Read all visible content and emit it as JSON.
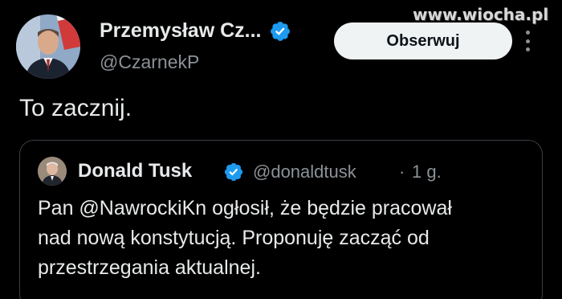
{
  "author": {
    "name": "Przemysław Cz...",
    "handle": "@CzarnekP"
  },
  "follow_button_label": "Obserwuj",
  "watermark": "www.wiocha.pl",
  "tweet": {
    "text": "To zacznij."
  },
  "quoted": {
    "name": "Donald Tusk",
    "handle": "@donaldtusk",
    "separator": "·",
    "time": "1 g.",
    "body_lines": [
      "Pan @NawrockiKn ogłosił, że będzie pracował",
      "nad nową konstytucją. Proponuję zacząć od",
      "przestrzegania aktualnej."
    ]
  },
  "colors": {
    "background": "#000000",
    "text": "#e7e9ea",
    "secondary": "#8b9196",
    "verified": "#1d9bf0",
    "button_bg": "#eff3f4",
    "border": "#3a3f44"
  },
  "icons": {
    "verified": "verified-badge-icon",
    "more": "more-options-icon"
  }
}
